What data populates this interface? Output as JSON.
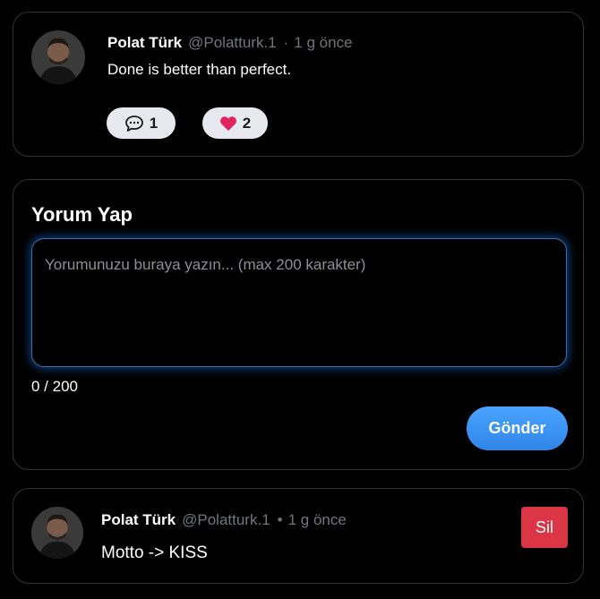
{
  "post": {
    "author_name": "Polat Türk",
    "handle": "@Polatturk.1",
    "separator": "·",
    "time": "1 g önce",
    "text": "Done is better than perfect.",
    "comment_count": "1",
    "like_count": "2",
    "icons": {
      "comment": "comment-bubble-icon",
      "like": "heart-icon"
    },
    "colors": {
      "like_heart": "#e0245e",
      "pill_bg": "#e7e9ee"
    }
  },
  "comment_form": {
    "title": "Yorum Yap",
    "placeholder": "Yorumunuzu buraya yazın... (max 200 karakter)",
    "value": "",
    "counter": "0 / 200",
    "submit_label": "Gönder",
    "colors": {
      "submit": "#3b93f5",
      "focus_glow": "#1d6edc"
    }
  },
  "comments": [
    {
      "author_name": "Polat Türk",
      "handle": "@Polatturk.1",
      "separator": "•",
      "time": "1 g önce",
      "text": "Motto -> KISS",
      "delete_label": "Sil",
      "colors": {
        "delete": "#dc3545"
      }
    }
  ]
}
